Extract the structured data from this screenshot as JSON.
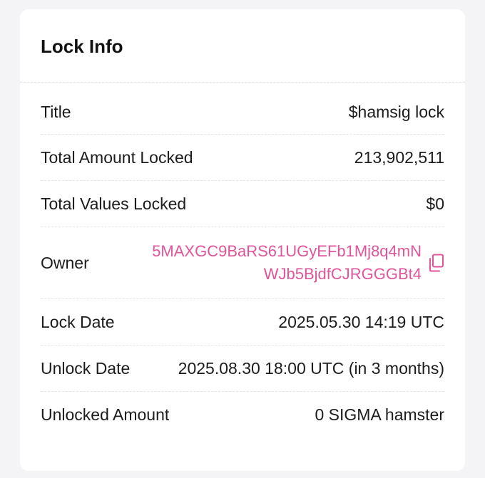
{
  "card": {
    "title": "Lock Info"
  },
  "rows": [
    {
      "label": "Title",
      "value": "$hamsig lock"
    },
    {
      "label": "Total Amount Locked",
      "value": "213,902,511"
    },
    {
      "label": "Total Values Locked",
      "value": "$0"
    },
    {
      "label": "Owner",
      "value_line1": "5MAXGC9BaRS61UGyEFb1Mj8q4mN",
      "value_line2": "WJb5BjdfCJRGGGBt4"
    },
    {
      "label": "Lock Date",
      "value": "2025.05.30 14:19 UTC"
    },
    {
      "label": "Unlock Date",
      "value": "2025.08.30 18:00 UTC (in 3 months)"
    },
    {
      "label": "Unlocked Amount",
      "value": "0 SIGMA hamster"
    }
  ],
  "icons": {
    "copy": "copy-icon"
  },
  "colors": {
    "accent": "#e0559a",
    "background": "#f4f4f6",
    "card": "#ffffff"
  }
}
